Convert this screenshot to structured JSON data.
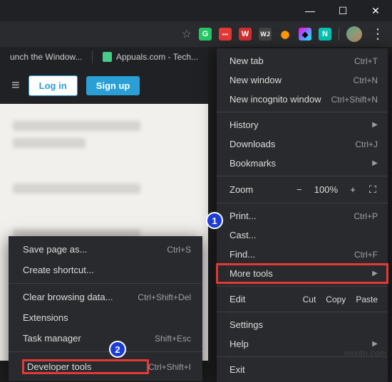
{
  "window": {
    "controls": [
      "—",
      "☐",
      "✕"
    ]
  },
  "toolbar": {
    "star": "☆",
    "extensions": [
      "G",
      "•••",
      "W",
      "WJ",
      "⬤",
      "◆",
      "N"
    ]
  },
  "tabs": [
    {
      "label": "unch the Window..."
    },
    {
      "label": "Appuals.com - Tech..."
    }
  ],
  "page": {
    "login_label": "Log in",
    "signup_label": "Sign up"
  },
  "main_menu": {
    "new_tab": {
      "label": "New tab",
      "shortcut": "Ctrl+T"
    },
    "new_window": {
      "label": "New window",
      "shortcut": "Ctrl+N"
    },
    "new_incognito": {
      "label": "New incognito window",
      "shortcut": "Ctrl+Shift+N"
    },
    "history": {
      "label": "History"
    },
    "downloads": {
      "label": "Downloads",
      "shortcut": "Ctrl+J"
    },
    "bookmarks": {
      "label": "Bookmarks"
    },
    "zoom": {
      "label": "Zoom",
      "value": "100%",
      "minus": "−",
      "plus": "+"
    },
    "print": {
      "label": "Print...",
      "shortcut": "Ctrl+P"
    },
    "cast": {
      "label": "Cast..."
    },
    "find": {
      "label": "Find...",
      "shortcut": "Ctrl+F"
    },
    "more_tools": {
      "label": "More tools"
    },
    "edit": {
      "label": "Edit",
      "cut": "Cut",
      "copy": "Copy",
      "paste": "Paste"
    },
    "settings": {
      "label": "Settings"
    },
    "help": {
      "label": "Help"
    },
    "exit": {
      "label": "Exit"
    }
  },
  "sub_menu": {
    "save_page": {
      "label": "Save page as...",
      "shortcut": "Ctrl+S"
    },
    "create_shortcut": {
      "label": "Create shortcut..."
    },
    "clear_data": {
      "label": "Clear browsing data...",
      "shortcut": "Ctrl+Shift+Del"
    },
    "extensions": {
      "label": "Extensions"
    },
    "task_manager": {
      "label": "Task manager",
      "shortcut": "Shift+Esc"
    },
    "dev_tools": {
      "label": "Developer tools",
      "shortcut": "Ctrl+Shift+I"
    }
  },
  "badges": {
    "one": "1",
    "two": "2"
  },
  "watermark": "wsxdn.com"
}
